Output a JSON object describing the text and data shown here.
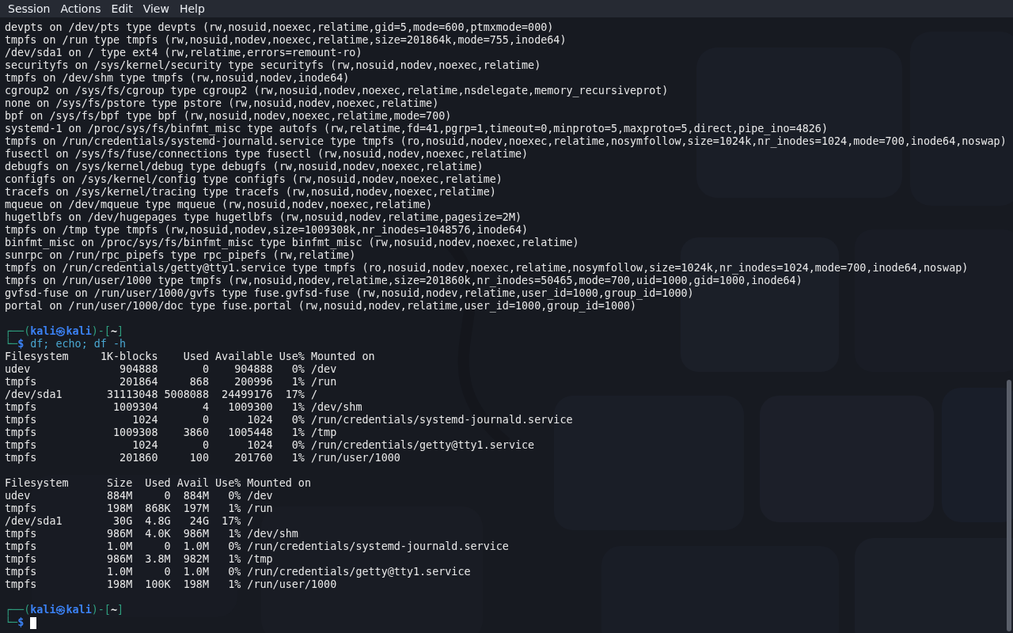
{
  "menu": [
    "Session",
    "Actions",
    "Edit",
    "View",
    "Help"
  ],
  "lines": [
    {
      "kind": "text",
      "text": "devpts on /dev/pts type devpts (rw,nosuid,noexec,relatime,gid=5,mode=600,ptmxmode=000)"
    },
    {
      "kind": "text",
      "text": "tmpfs on /run type tmpfs (rw,nosuid,nodev,noexec,relatime,size=201864k,mode=755,inode64)"
    },
    {
      "kind": "text",
      "text": "/dev/sda1 on / type ext4 (rw,relatime,errors=remount-ro)"
    },
    {
      "kind": "text",
      "text": "securityfs on /sys/kernel/security type securityfs (rw,nosuid,nodev,noexec,relatime)"
    },
    {
      "kind": "text",
      "text": "tmpfs on /dev/shm type tmpfs (rw,nosuid,nodev,inode64)"
    },
    {
      "kind": "text",
      "text": "cgroup2 on /sys/fs/cgroup type cgroup2 (rw,nosuid,nodev,noexec,relatime,nsdelegate,memory_recursiveprot)"
    },
    {
      "kind": "text",
      "text": "none on /sys/fs/pstore type pstore (rw,nosuid,nodev,noexec,relatime)"
    },
    {
      "kind": "text",
      "text": "bpf on /sys/fs/bpf type bpf (rw,nosuid,nodev,noexec,relatime,mode=700)"
    },
    {
      "kind": "text",
      "text": "systemd-1 on /proc/sys/fs/binfmt_misc type autofs (rw,relatime,fd=41,pgrp=1,timeout=0,minproto=5,maxproto=5,direct,pipe_ino=4826)"
    },
    {
      "kind": "text",
      "text": "tmpfs on /run/credentials/systemd-journald.service type tmpfs (ro,nosuid,nodev,noexec,relatime,nosymfollow,size=1024k,nr_inodes=1024,mode=700,inode64,noswap)"
    },
    {
      "kind": "text",
      "text": "fusectl on /sys/fs/fuse/connections type fusectl (rw,nosuid,nodev,noexec,relatime)"
    },
    {
      "kind": "text",
      "text": "debugfs on /sys/kernel/debug type debugfs (rw,nosuid,nodev,noexec,relatime)"
    },
    {
      "kind": "text",
      "text": "configfs on /sys/kernel/config type configfs (rw,nosuid,nodev,noexec,relatime)"
    },
    {
      "kind": "text",
      "text": "tracefs on /sys/kernel/tracing type tracefs (rw,nosuid,nodev,noexec,relatime)"
    },
    {
      "kind": "text",
      "text": "mqueue on /dev/mqueue type mqueue (rw,nosuid,nodev,noexec,relatime)"
    },
    {
      "kind": "text",
      "text": "hugetlbfs on /dev/hugepages type hugetlbfs (rw,nosuid,nodev,relatime,pagesize=2M)"
    },
    {
      "kind": "text",
      "text": "tmpfs on /tmp type tmpfs (rw,nosuid,nodev,size=1009308k,nr_inodes=1048576,inode64)"
    },
    {
      "kind": "text",
      "text": "binfmt_misc on /proc/sys/fs/binfmt_misc type binfmt_misc (rw,nosuid,nodev,noexec,relatime)"
    },
    {
      "kind": "text",
      "text": "sunrpc on /run/rpc_pipefs type rpc_pipefs (rw,relatime)"
    },
    {
      "kind": "text",
      "text": "tmpfs on /run/credentials/getty@tty1.service type tmpfs (ro,nosuid,nodev,noexec,relatime,nosymfollow,size=1024k,nr_inodes=1024,mode=700,inode64,noswap)"
    },
    {
      "kind": "text",
      "text": "tmpfs on /run/user/1000 type tmpfs (rw,nosuid,nodev,relatime,size=201860k,nr_inodes=50465,mode=700,uid=1000,gid=1000,inode64)"
    },
    {
      "kind": "text",
      "text": "gvfsd-fuse on /run/user/1000/gvfs type fuse.gvfsd-fuse (rw,nosuid,nodev,relatime,user_id=1000,group_id=1000)"
    },
    {
      "kind": "text",
      "text": "portal on /run/user/1000/doc type fuse.portal (rw,nosuid,nodev,relatime,user_id=1000,group_id=1000)"
    },
    {
      "kind": "blank"
    },
    {
      "kind": "prompt",
      "frame_open": "┌──(",
      "user_host": "kali㉿kali",
      "frame_mid": ")-[",
      "dir": "~",
      "frame_close": "]",
      "frame_bottom": "└─",
      "symbol": "$",
      "command": "df; echo; df -h",
      "cursor": false
    },
    {
      "kind": "text",
      "text": "Filesystem     1K-blocks    Used Available Use% Mounted on"
    },
    {
      "kind": "text",
      "text": "udev              904888       0    904888   0% /dev"
    },
    {
      "kind": "text",
      "text": "tmpfs             201864     868    200996   1% /run"
    },
    {
      "kind": "text",
      "text": "/dev/sda1       31113048 5008088  24499176  17% /"
    },
    {
      "kind": "text",
      "text": "tmpfs            1009304       4   1009300   1% /dev/shm"
    },
    {
      "kind": "text",
      "text": "tmpfs               1024       0      1024   0% /run/credentials/systemd-journald.service"
    },
    {
      "kind": "text",
      "text": "tmpfs            1009308    3860   1005448   1% /tmp"
    },
    {
      "kind": "text",
      "text": "tmpfs               1024       0      1024   0% /run/credentials/getty@tty1.service"
    },
    {
      "kind": "text",
      "text": "tmpfs             201860     100    201760   1% /run/user/1000"
    },
    {
      "kind": "blank"
    },
    {
      "kind": "text",
      "text": "Filesystem      Size  Used Avail Use% Mounted on"
    },
    {
      "kind": "text",
      "text": "udev            884M     0  884M   0% /dev"
    },
    {
      "kind": "text",
      "text": "tmpfs           198M  868K  197M   1% /run"
    },
    {
      "kind": "text",
      "text": "/dev/sda1        30G  4.8G   24G  17% /"
    },
    {
      "kind": "text",
      "text": "tmpfs           986M  4.0K  986M   1% /dev/shm"
    },
    {
      "kind": "text",
      "text": "tmpfs           1.0M     0  1.0M   0% /run/credentials/systemd-journald.service"
    },
    {
      "kind": "text",
      "text": "tmpfs           986M  3.8M  982M   1% /tmp"
    },
    {
      "kind": "text",
      "text": "tmpfs           1.0M     0  1.0M   0% /run/credentials/getty@tty1.service"
    },
    {
      "kind": "text",
      "text": "tmpfs           198M  100K  198M   1% /run/user/1000"
    },
    {
      "kind": "blank"
    },
    {
      "kind": "prompt",
      "frame_open": "┌──(",
      "user_host": "kali㉿kali",
      "frame_mid": ")-[",
      "dir": "~",
      "frame_close": "]",
      "frame_bottom": "└─",
      "symbol": "$",
      "cursor": true
    }
  ]
}
